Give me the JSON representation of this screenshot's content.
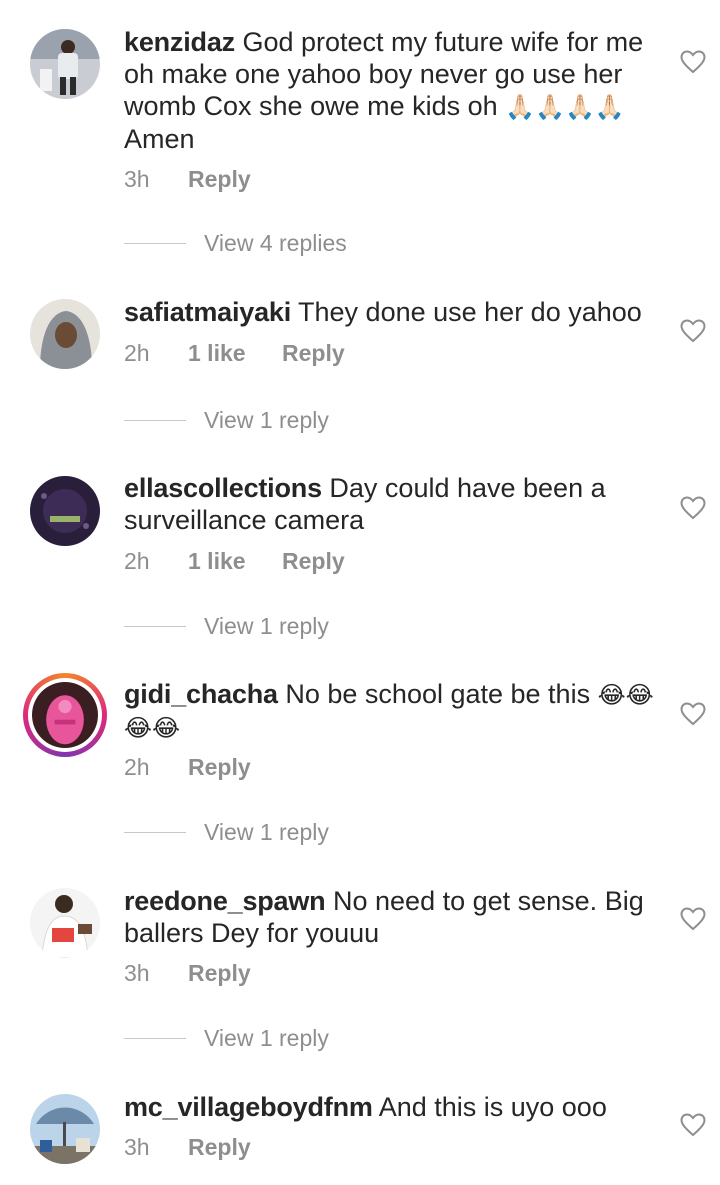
{
  "comments": [
    {
      "username": "kenzidaz",
      "lines": [
        "God protect my future wife for me",
        "oh make one yahoo boy never go use her",
        "womb Cox she owe me kids oh",
        "Amen"
      ],
      "emoji": "🙏🏻🙏🏻🙏🏻🙏🏻",
      "time": "3h",
      "likes": "",
      "reply": "Reply",
      "view_replies": "View 4 replies"
    },
    {
      "username": "safiatmaiyaki",
      "lines": [
        "They done use her do yahoo"
      ],
      "time": "2h",
      "likes": "1 like",
      "reply": "Reply",
      "view_replies": "View 1 reply"
    },
    {
      "username": "ellascollections",
      "lines": [
        "Day could have been a",
        "surveillance camera"
      ],
      "time": "2h",
      "likes": "1 like",
      "reply": "Reply",
      "view_replies": "View 1 reply"
    },
    {
      "username": "gidi_chacha",
      "lines": [
        "No be school gate be this"
      ],
      "emoji": "😂😂",
      "emoji2": "😂😂",
      "time": "2h",
      "likes": "",
      "reply": "Reply",
      "view_replies": "View 1 reply"
    },
    {
      "username": "reedone_spawn",
      "lines": [
        "No need to get sense. Big",
        "ballers Dey for youuu"
      ],
      "time": "3h",
      "likes": "",
      "reply": "Reply",
      "view_replies": "View 1 reply"
    },
    {
      "username": "mc_villageboydfnm",
      "lines": [
        "And this is uyo ooo"
      ],
      "time": "3h",
      "likes": "",
      "reply": "Reply",
      "view_replies": ""
    }
  ],
  "icons": {
    "like": "heart-outline-icon"
  },
  "colors": {
    "text": "#262626",
    "secondary": "#8e8e8e",
    "divider": "#c7c7c7"
  }
}
